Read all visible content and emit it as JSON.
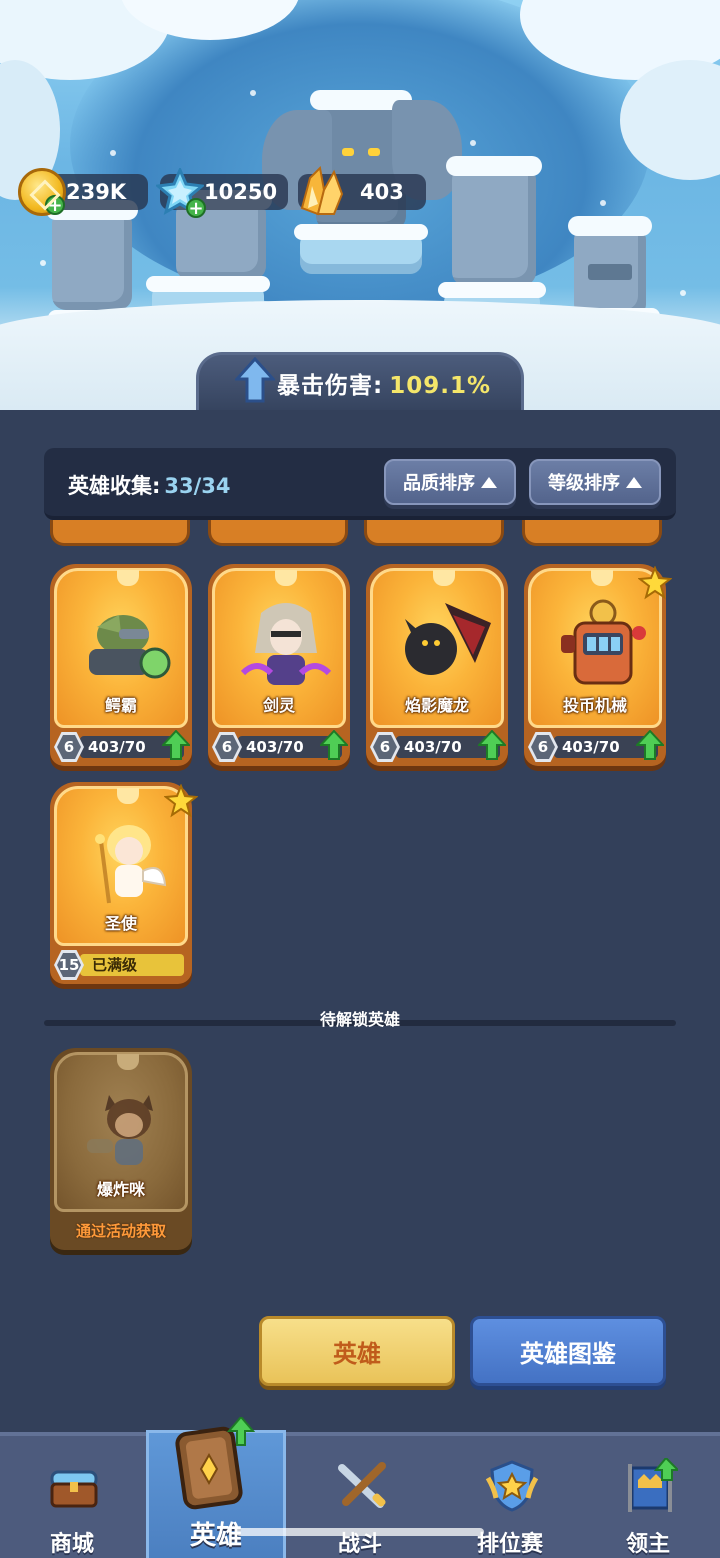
{
  "currencies": {
    "gold": "239K",
    "ice": "10250",
    "crystal": "403"
  },
  "crit": {
    "label": "暴击伤害:",
    "value": "109.1%"
  },
  "collection": {
    "label": "英雄收集:",
    "count": "33/34",
    "sort_quality": "品质排序",
    "sort_level": "等级排序"
  },
  "heroes": [
    {
      "name": "鳄霸",
      "level": "6",
      "progress": "403/70"
    },
    {
      "name": "剑灵",
      "level": "6",
      "progress": "403/70"
    },
    {
      "name": "焰影魔龙",
      "level": "6",
      "progress": "403/70"
    },
    {
      "name": "投币机械",
      "level": "6",
      "progress": "403/70"
    },
    {
      "name": "圣使",
      "level": "15",
      "progress": "已满级"
    }
  ],
  "locked_section": {
    "title": "待解锁英雄",
    "heroes": [
      {
        "name": "爆炸咪",
        "obtain": "通过活动获取"
      }
    ]
  },
  "toggle": {
    "heroes": "英雄",
    "codex": "英雄图鉴"
  },
  "nav": {
    "shop": "商城",
    "heroes": "英雄",
    "battle": "战斗",
    "ranked": "排位赛",
    "lord": "领主"
  },
  "colors": {
    "background": "#33405a",
    "card_orange": "#fbb43a",
    "accent_green": "#45b44a",
    "crit_value": "#f4e66a"
  }
}
